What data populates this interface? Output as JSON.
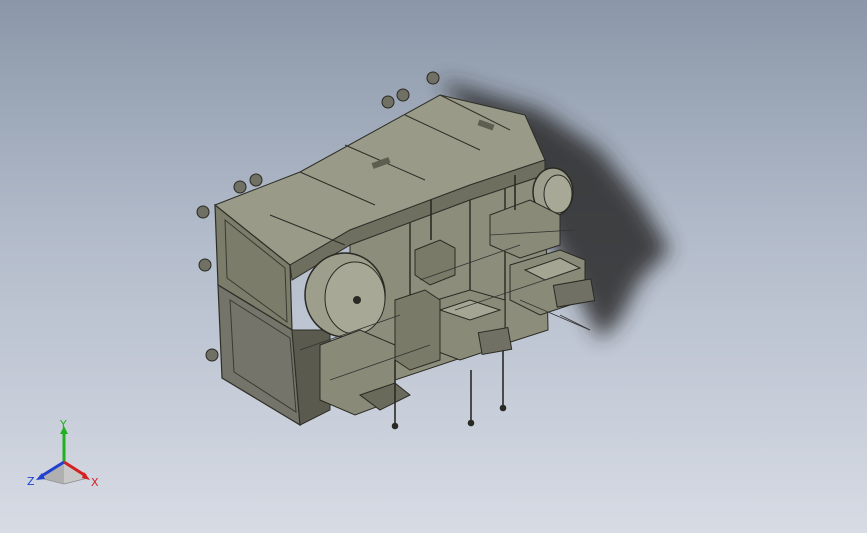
{
  "viewport": {
    "background_top": "#8b97a8",
    "background_bottom": "#d7dbe4",
    "model_color": "#8a8a78",
    "model_dark": "#3c3c34",
    "model_light": "#b8b8a6"
  },
  "triad": {
    "x_label": "X",
    "y_label": "Y",
    "z_label": "Z",
    "x_color": "#d42020",
    "y_color": "#20b020",
    "z_color": "#2040d0"
  }
}
